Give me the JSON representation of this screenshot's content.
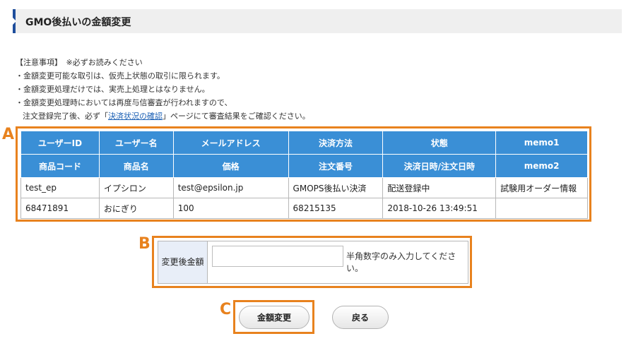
{
  "page": {
    "title": "GMO後払いの金額変更"
  },
  "notice": {
    "heading": "【注意事項】　※必ずお読みください",
    "line1": "・金額変更可能な取引は、仮売上状態の取引に限られます。",
    "line2": "・金額変更処理だけでは、実売上処理とはなりません。",
    "line3": "・金額変更処理時においては再度与信審査が行われますので、",
    "line4_prefix": "注文登録完了後、必ず「",
    "line4_link": "決済状況の確認",
    "line4_suffix": "」ページにて審査結果をご確認ください。"
  },
  "markers": {
    "a": "A",
    "b": "B",
    "c": "C"
  },
  "table": {
    "header1": [
      "ユーザーID",
      "ユーザー名",
      "メールアドレス",
      "決済方法",
      "状態",
      "memo1"
    ],
    "values1": [
      "test_ep",
      "イプシロン",
      "test@epsilon.jp",
      "GMOPS後払い決済",
      "配送登録中",
      "試験用オーダー情報"
    ],
    "header2": [
      "商品コード",
      "商品名",
      "価格",
      "注文番号",
      "決済日時/注文日時",
      "memo2"
    ],
    "values2": [
      "68471891",
      "おにぎり",
      "100",
      "68215135",
      "2018-10-26 13:49:51",
      ""
    ]
  },
  "form": {
    "amount_label": "変更後金額",
    "amount_value": "",
    "amount_hint": "半角数字のみ入力してください。"
  },
  "buttons": {
    "change": "金額変更",
    "back": "戻る"
  },
  "colors": {
    "accent_orange": "#e8821e",
    "header_blue": "#3a8fd6",
    "title_bar_accent": "#1f4e9c"
  }
}
